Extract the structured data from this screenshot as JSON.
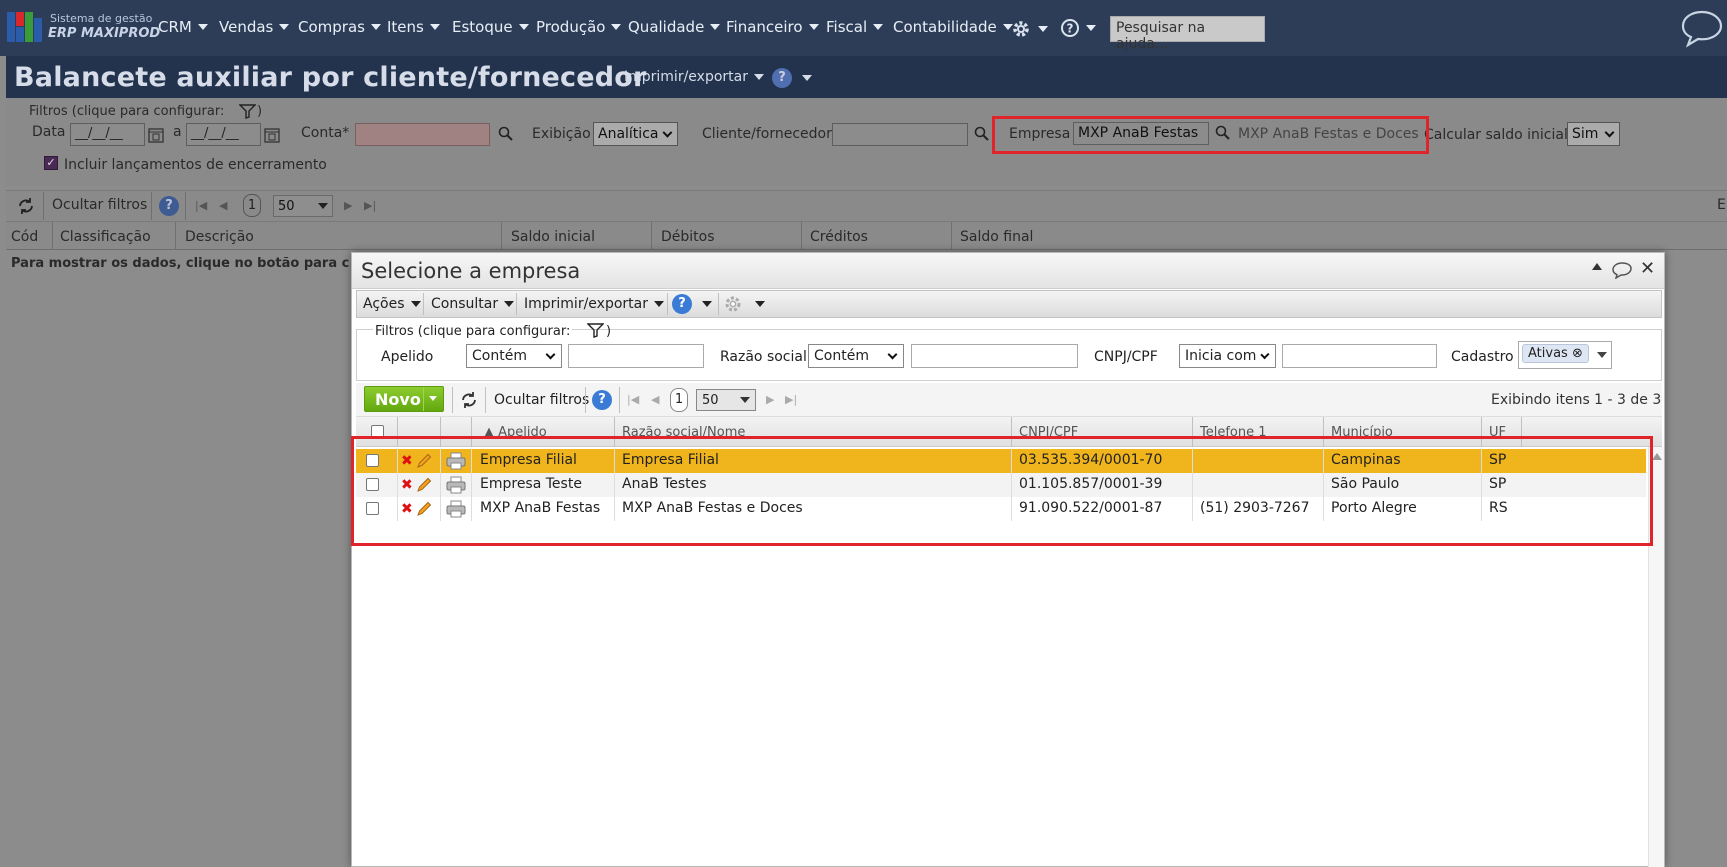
{
  "brand": {
    "line1": "Sistema de gestão",
    "line2": "ERP MAXIPROD"
  },
  "nav": {
    "items": [
      "CRM",
      "Vendas",
      "Compras",
      "Itens",
      "Estoque",
      "Produção",
      "Qualidade",
      "Financeiro",
      "Fiscal",
      "Contabilidade"
    ],
    "help_search_placeholder": "Pesquisar na ajuda..."
  },
  "page": {
    "title": "Balancete auxiliar por cliente/fornecedor",
    "print_menu": "Imprimir/exportar"
  },
  "filters": {
    "legend": "Filtros (clique para configurar:",
    "legend_close": ")",
    "data_label": "Data",
    "date_placeholder": "__/__/__",
    "date_sep": "a",
    "conta_label": "Conta*",
    "exibicao_label": "Exibição",
    "exibicao_value": "Analítica",
    "cliente_label": "Cliente/fornecedor",
    "empresa_label": "Empresa",
    "empresa_value": "MXP AnaB Festas",
    "empresa_desc": "MXP AnaB Festas e Doces",
    "saldo_label": "Calcular saldo inicial",
    "saldo_value": "Sim",
    "encerramento_label": "Incluir lançamentos de encerramento",
    "encerramento_checked": true
  },
  "toolbar": {
    "hide_filters": "Ocultar filtros",
    "page": "1",
    "page_size": "50",
    "right_cut": "E"
  },
  "grid": {
    "columns": [
      "Cód",
      "Classificação",
      "Descrição",
      "Saldo inicial",
      "Débitos",
      "Créditos",
      "Saldo final"
    ],
    "empty_msg": "Para mostrar os dados, clique no botão para c"
  },
  "modal": {
    "title": "Selecione a empresa",
    "menu": [
      "Ações",
      "Consultar",
      "Imprimir/exportar"
    ],
    "filters": {
      "legend": "Filtros (clique para configurar:",
      "legend_close": ")",
      "apelido_label": "Apelido",
      "apelido_op": "Contém",
      "razao_label": "Razão social",
      "razao_op": "Contém",
      "cnpj_label": "CNPJ/CPF",
      "cnpj_op": "Inicia com",
      "cadastro_label": "Cadastro",
      "cadastro_tag": "Ativas"
    },
    "novo_label": "Novo",
    "hide_filters": "Ocultar filtros",
    "page": "1",
    "page_size": "50",
    "count_text": "Exibindo itens 1 - 3 de 3",
    "columns": [
      "Apelido",
      "Razão social/Nome",
      "CNPJ/CPF",
      "Telefone 1",
      "Município",
      "UF"
    ],
    "rows": [
      {
        "apelido": "Empresa Filial",
        "razao": "Empresa Filial",
        "cnpj": "03.535.394/0001-70",
        "telefone": "",
        "municipio": "Campinas",
        "uf": "SP",
        "selected": true
      },
      {
        "apelido": "Empresa Teste",
        "razao": "AnaB Testes",
        "cnpj": "01.105.857/0001-39",
        "telefone": "",
        "municipio": "São Paulo",
        "uf": "SP",
        "selected": false
      },
      {
        "apelido": "MXP AnaB Festas",
        "razao": "MXP AnaB Festas e Doces",
        "cnpj": "91.090.522/0001-87",
        "telefone": "(51) 2903-7267",
        "municipio": "Porto Alegre",
        "uf": "RS",
        "selected": false
      }
    ]
  },
  "colors": {
    "highlight": "#e0242a",
    "selected_row": "#f0b41c",
    "novo_green": "#6fb51a",
    "nav_bg": "#2d3d58"
  }
}
